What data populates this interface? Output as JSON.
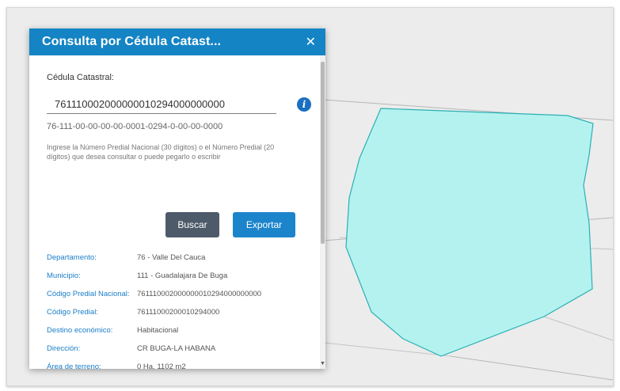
{
  "panel": {
    "title": "Consulta por Cédula Catast...",
    "close_icon": "close-icon",
    "field_label": "Cédula Catastral:",
    "cedula_value": "761110002000000010294000000000",
    "info_icon": "info-icon",
    "formatted_value": "76-111-00-00-00-00-0001-0294-0-00-00-0000",
    "instructions": "Ingrese la Número Predial Nacional (30 dígitos) o el Número Predial (20 dígitos) que desea consultar o puede pegarlo o escribir",
    "buscar_label": "Buscar",
    "exportar_label": "Exportar",
    "attributes": [
      {
        "key": "Departamento:",
        "value": "76 - Valle Del Cauca"
      },
      {
        "key": "Municipio:",
        "value": "111 - Guadalajara De Buga"
      },
      {
        "key": "Código Predial Nacional:",
        "value": "761110002000000010294000000000"
      },
      {
        "key": "Código Predial:",
        "value": "76111000200010294000"
      },
      {
        "key": "Destino económico:",
        "value": "Habitacional"
      },
      {
        "key": "Dirección:",
        "value": "CR BUGA-LA HABANA"
      },
      {
        "key": "Área de terreno:",
        "value": "0 Ha, 1102 m2"
      }
    ]
  },
  "colors": {
    "header": "#1484c4",
    "parcel_fill": "#b4f2f0",
    "parcel_stroke": "#2ab0b4",
    "buscar": "#4d5a69",
    "exportar": "#1c84cb",
    "attr_key": "#1a7ec8"
  }
}
